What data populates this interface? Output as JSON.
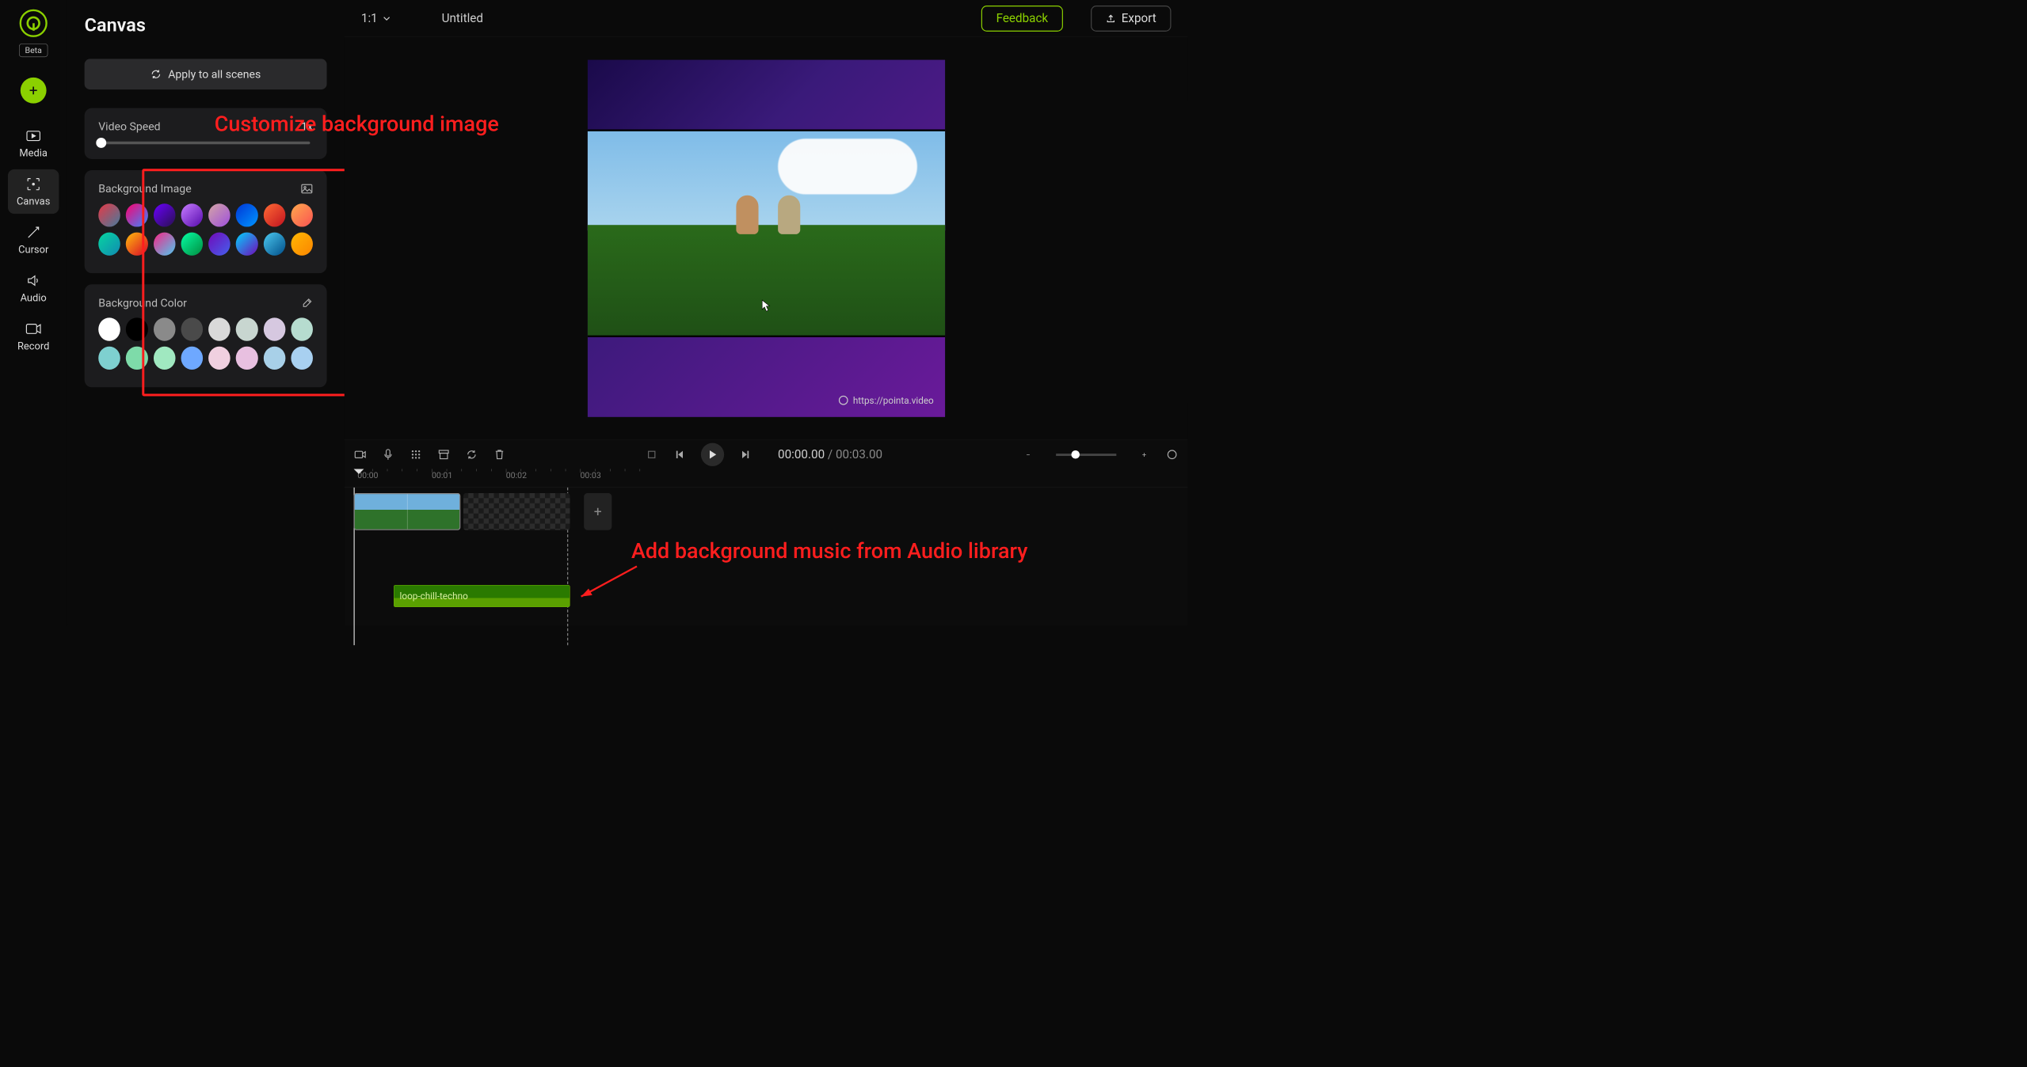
{
  "rail": {
    "beta": "Beta",
    "items": [
      {
        "id": "media",
        "label": "Media"
      },
      {
        "id": "canvas",
        "label": "Canvas"
      },
      {
        "id": "cursor",
        "label": "Cursor"
      },
      {
        "id": "audio",
        "label": "Audio"
      },
      {
        "id": "record",
        "label": "Record"
      }
    ]
  },
  "panel": {
    "title": "Canvas",
    "apply_all": "Apply to all scenes",
    "video_speed": {
      "label": "Video Speed",
      "value": "1x"
    },
    "bg_image": {
      "label": "Background Image"
    },
    "bg_color": {
      "label": "Background Color"
    },
    "image_swatches": [
      [
        "linear-gradient(135deg,#e63946,#457b9d)",
        "linear-gradient(135deg,#ff006e,#3a86ff)",
        "linear-gradient(135deg,#6a00ff,#28104e)",
        "linear-gradient(135deg,#c77dff,#560bad)",
        "linear-gradient(135deg,#d4a5a5,#9d4edd)",
        "linear-gradient(135deg,#0036d6,#0096ff)",
        "linear-gradient(135deg,#ff6b35,#c1121f)",
        "linear-gradient(135deg,#ffa94d,#fa5252)"
      ],
      [
        "linear-gradient(135deg,#06d6a0,#118ab2)",
        "linear-gradient(135deg,#ffbe0b,#d90429)",
        "linear-gradient(135deg,#f72585,#4cc9f0)",
        "linear-gradient(135deg,#06ffa5,#008b3e)",
        "linear-gradient(135deg,#7209b7,#4361ee)",
        "linear-gradient(135deg,#00d4ff,#7209b7)",
        "linear-gradient(135deg,#4cc9f0,#004e89)",
        "linear-gradient(135deg,#ffb703,#fb8500)"
      ]
    ],
    "color_swatches": [
      [
        "#ffffff",
        "#000000",
        "#8a8a8a",
        "#4a4a4a",
        "#d9d9d9",
        "#c8d6d0",
        "#d6c8e0",
        "#b6dccf"
      ],
      [
        "#7ed0d0",
        "#7edba9",
        "#a0e8c0",
        "#6ea8ff",
        "#f0d0e0",
        "#e8c0e0",
        "#a8d0e8",
        "#a8d0f0"
      ]
    ]
  },
  "header": {
    "aspect": "1:1",
    "doc_name": "Untitled",
    "feedback": "Feedback",
    "export": "Export"
  },
  "preview": {
    "watermark": "https://pointa.video"
  },
  "timeline": {
    "current": "00:00.00",
    "duration": "00:03.00",
    "ticks": [
      "00:00",
      "00:01",
      "00:02",
      "00:03"
    ],
    "audio_clip_label": "loop-chill-techno"
  },
  "annotations": {
    "bg_image": "Customize background image",
    "audio": "Add background music from Audio library"
  }
}
